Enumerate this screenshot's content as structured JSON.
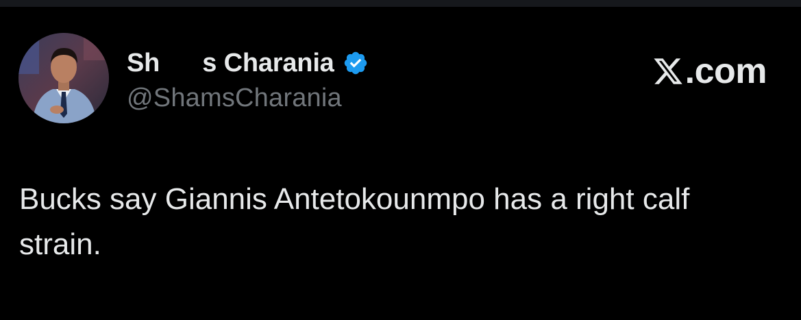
{
  "tweet": {
    "author": {
      "display_name": "Sh      s Charania",
      "handle": "@ShamsCharania",
      "verified": true,
      "avatar": "profile-photo"
    },
    "text": "Bucks say Giannis Antetokounmpo has a right calf strain."
  },
  "brand": {
    "logo_icon": "x-logo-icon",
    "text": ".com"
  },
  "colors": {
    "background": "#000000",
    "primary_text": "#e7e9ea",
    "secondary_text": "#71767b",
    "verified_blue": "#1d9bf0"
  }
}
